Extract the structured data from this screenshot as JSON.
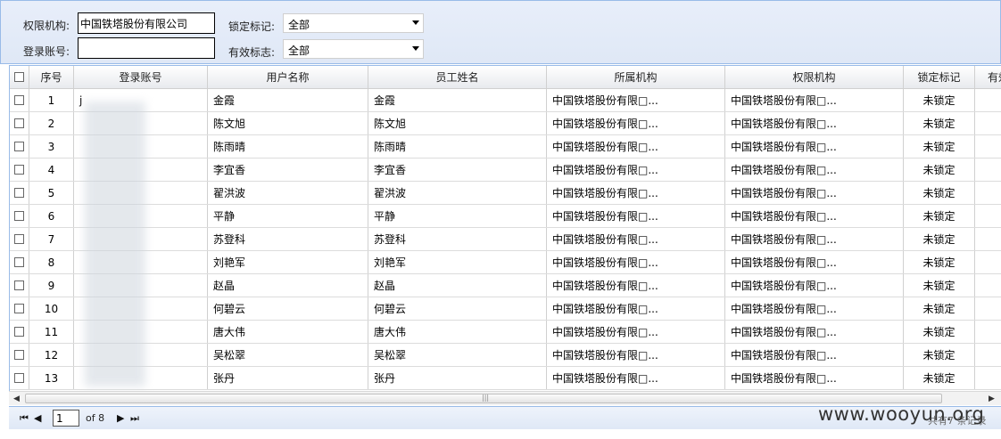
{
  "filters": {
    "org_label": "权限机构:",
    "org_value": "中国铁塔股份有限公司",
    "account_label": "登录账号:",
    "account_value": "",
    "lock_label": "锁定标记:",
    "lock_value": "全部",
    "valid_label": "有效标志:",
    "valid_value": "全部"
  },
  "columns": [
    "序号",
    "登录账号",
    "用户名称",
    "员工姓名",
    "所属机构",
    "权限机构",
    "锁定标记",
    "有效"
  ],
  "rows": [
    {
      "no": "1",
      "account": "j",
      "user": "金霞",
      "emp": "金霞",
      "org": "中国铁塔股份有限□...",
      "perm": "中国铁塔股份有限□...",
      "lock": "未锁定"
    },
    {
      "no": "2",
      "account": "",
      "user": "陈文旭",
      "emp": "陈文旭",
      "org": "中国铁塔股份有限□...",
      "perm": "中国铁塔股份有限□...",
      "lock": "未锁定"
    },
    {
      "no": "3",
      "account": "",
      "user": "陈雨晴",
      "emp": "陈雨晴",
      "org": "中国铁塔股份有限□...",
      "perm": "中国铁塔股份有限□...",
      "lock": "未锁定"
    },
    {
      "no": "4",
      "account": "",
      "user": "李宜香",
      "emp": "李宜香",
      "org": "中国铁塔股份有限□...",
      "perm": "中国铁塔股份有限□...",
      "lock": "未锁定"
    },
    {
      "no": "5",
      "account": "",
      "user": "翟洪波",
      "emp": "翟洪波",
      "org": "中国铁塔股份有限□...",
      "perm": "中国铁塔股份有限□...",
      "lock": "未锁定"
    },
    {
      "no": "6",
      "account": "",
      "user": "平静",
      "emp": "平静",
      "org": "中国铁塔股份有限□...",
      "perm": "中国铁塔股份有限□...",
      "lock": "未锁定"
    },
    {
      "no": "7",
      "account": "",
      "user": "苏登科",
      "emp": "苏登科",
      "org": "中国铁塔股份有限□...",
      "perm": "中国铁塔股份有限□...",
      "lock": "未锁定"
    },
    {
      "no": "8",
      "account": "",
      "user": "刘艳军",
      "emp": "刘艳军",
      "org": "中国铁塔股份有限□...",
      "perm": "中国铁塔股份有限□...",
      "lock": "未锁定"
    },
    {
      "no": "9",
      "account": "",
      "user": "赵晶",
      "emp": "赵晶",
      "org": "中国铁塔股份有限□...",
      "perm": "中国铁塔股份有限□...",
      "lock": "未锁定"
    },
    {
      "no": "10",
      "account": "",
      "user": "何碧云",
      "emp": "何碧云",
      "org": "中国铁塔股份有限□...",
      "perm": "中国铁塔股份有限□...",
      "lock": "未锁定"
    },
    {
      "no": "11",
      "account": "",
      "user": "唐大伟",
      "emp": "唐大伟",
      "org": "中国铁塔股份有限□...",
      "perm": "中国铁塔股份有限□...",
      "lock": "未锁定"
    },
    {
      "no": "12",
      "account": "",
      "user": "吴松翠",
      "emp": "吴松翠",
      "org": "中国铁塔股份有限□...",
      "perm": "中国铁塔股份有限□...",
      "lock": "未锁定"
    },
    {
      "no": "13",
      "account": "",
      "user": "张丹",
      "emp": "张丹",
      "org": "中国铁塔股份有限□...",
      "perm": "中国铁塔股份有限□...",
      "lock": "未锁定"
    }
  ],
  "pager": {
    "first_icon": "first-page-icon",
    "prev_icon": "prev-page-icon",
    "next_icon": "next-page-icon",
    "last_icon": "last-page-icon",
    "current_page": "1",
    "of_text": "of 8",
    "records_text": "共有7 条记录"
  },
  "watermark": "www.wooyun.org",
  "colors": {
    "header_border": "#99bbe8",
    "panel_bg": "#dfe8f6"
  }
}
